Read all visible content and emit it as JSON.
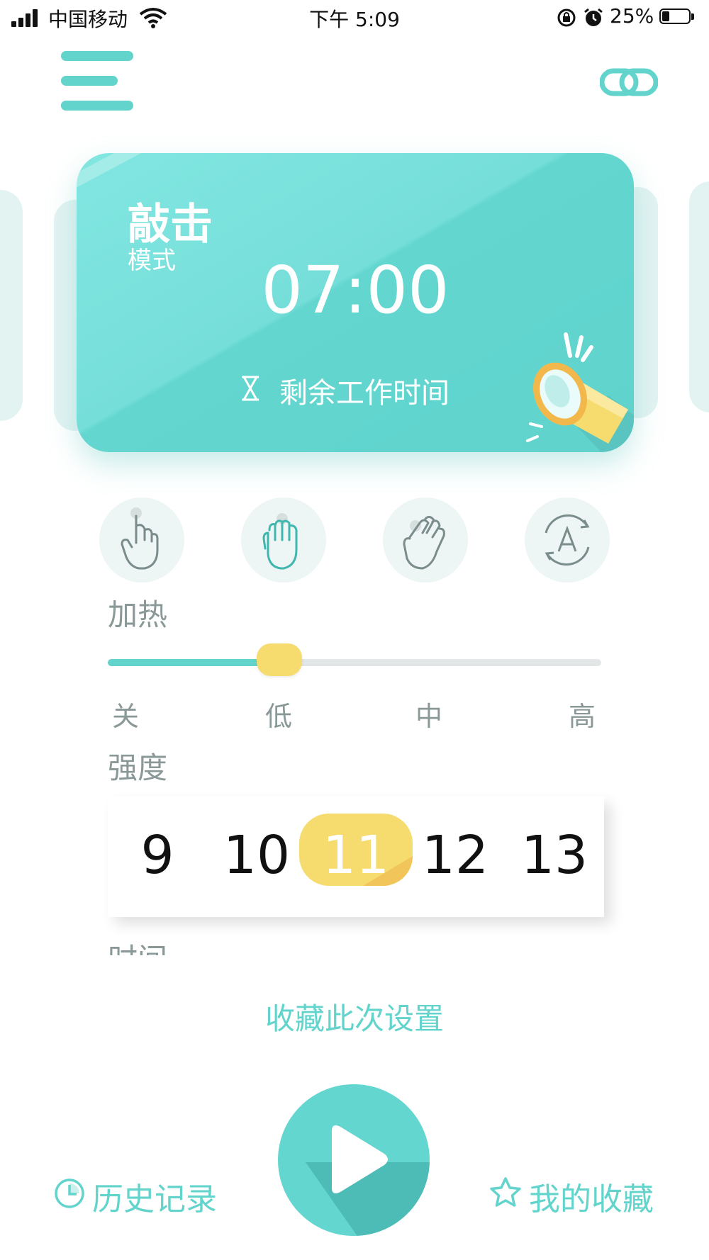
{
  "status_bar": {
    "carrier": "中国移动",
    "time": "下午 5:09",
    "battery": "25%"
  },
  "card": {
    "mode_title": "敲击",
    "mode_subtitle": "模式",
    "timer": "07:00",
    "remaining_label": "剩余工作时间"
  },
  "techniques": [
    {
      "icon": "tap-hand-icon"
    },
    {
      "icon": "knead-fist-icon"
    },
    {
      "icon": "grab-hand-icon"
    },
    {
      "icon": "auto-mode-icon"
    }
  ],
  "heat": {
    "label": "加热",
    "options": [
      "关",
      "低",
      "中",
      "高"
    ],
    "selected": "低"
  },
  "intensity": {
    "label": "强度",
    "values": [
      "9",
      "10",
      "11",
      "12",
      "13"
    ],
    "selected": "11"
  },
  "time_label": "时间",
  "save_settings": "收藏此次设置",
  "bottom": {
    "history": "历史记录",
    "favorites": "我的收藏"
  },
  "colors": {
    "accent": "#62d4cc",
    "highlight": "#f6dc6f",
    "label_gray": "#8a9898"
  }
}
